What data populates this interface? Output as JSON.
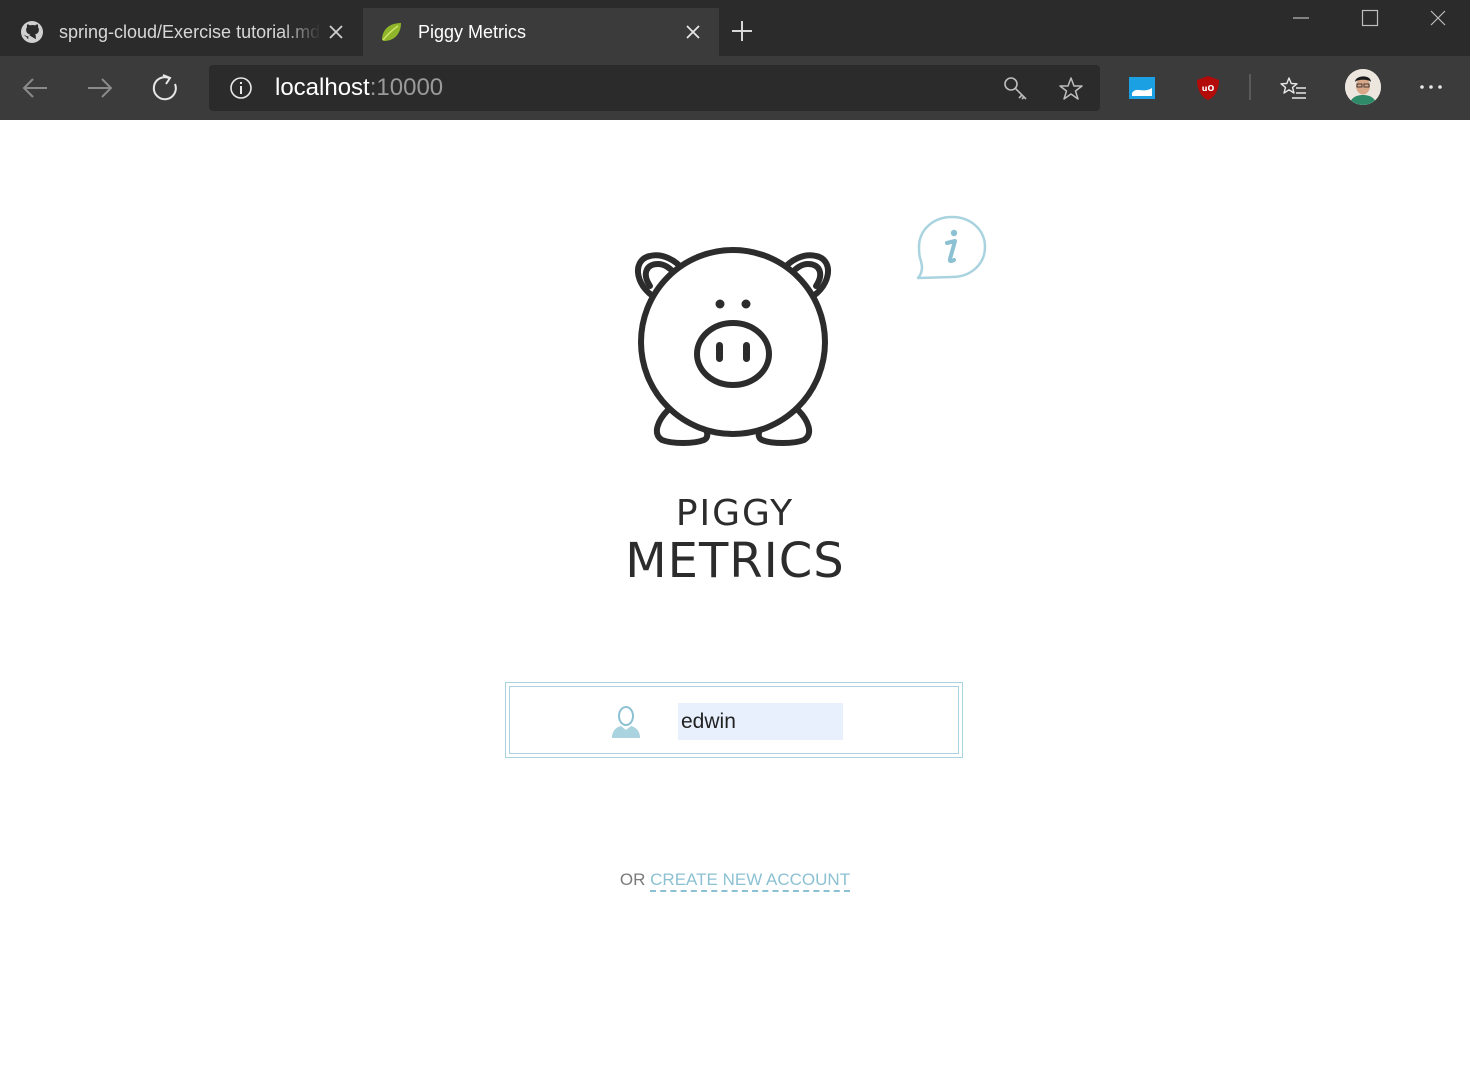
{
  "browser": {
    "tabs": [
      {
        "title": "spring-cloud/Exercise tutorial.md",
        "icon": "github-icon",
        "active": false
      },
      {
        "title": "Piggy Metrics",
        "icon": "leaf-icon",
        "active": true
      }
    ],
    "address": {
      "host": "localhost",
      "port": ":10000"
    },
    "extensions": [
      "reading-list-icon",
      "ublock-icon"
    ],
    "colors": {
      "tabbar": "#2b2b2b",
      "toolbar": "#3b3b3b",
      "active_tab": "#3b3b3b"
    }
  },
  "app": {
    "brand_line1": "PIGGY",
    "brand_line2": "METRICS",
    "login": {
      "username_value": "edwin",
      "icon": "user-icon"
    },
    "or_text": "OR",
    "create_account_link": "CREATE NEW ACCOUNT",
    "colors": {
      "accent": "#8cc1d3",
      "border": "#a9d3df",
      "ink": "#2c2c2c"
    }
  }
}
